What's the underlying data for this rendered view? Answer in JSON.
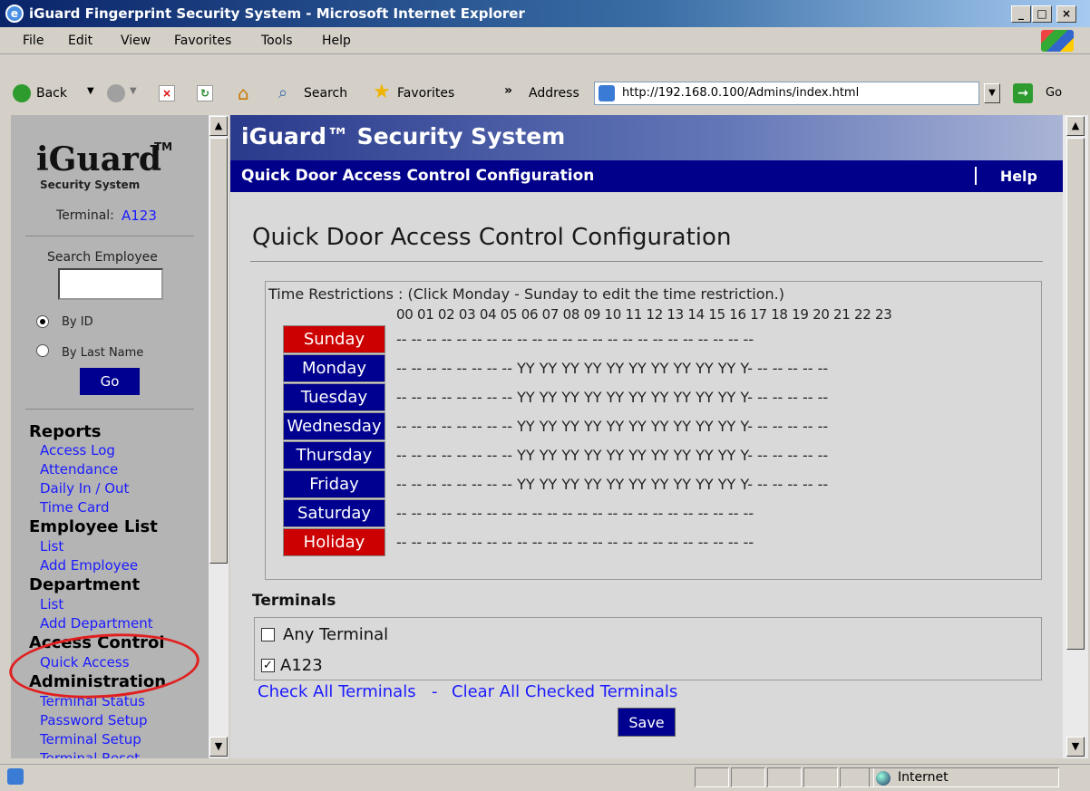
{
  "window": {
    "title": "iGuard Fingerprint Security System - Microsoft Internet Explorer"
  },
  "menu": [
    "File",
    "Edit",
    "View",
    "Favorites",
    "Tools",
    "Help"
  ],
  "toolbar": {
    "back": "Back",
    "search": "Search",
    "favorites": "Favorites",
    "address_label": "Address",
    "url": "http://192.168.0.100/Admins/index.html",
    "go": "Go"
  },
  "sidebar": {
    "logo": "iGuard",
    "logo_tm": "TM",
    "logo_sub": "Security System",
    "terminal_label": "Terminal:",
    "terminal_value": "A123",
    "search_label": "Search Employee",
    "search_value": "",
    "by_id": "By ID",
    "by_last_name": "By Last Name",
    "go": "Go",
    "reports": "Reports",
    "access_log": "Access Log",
    "attendance": "Attendance",
    "daily": "Daily In / Out",
    "time_card": "Time Card",
    "employee_list": "Employee List",
    "emp_list": "List",
    "add_employee": "Add Employee",
    "department": "Department",
    "dept_list": "List",
    "add_department": "Add Department",
    "access_control": "Access Control",
    "quick_access": "Quick Access",
    "administration": "Administration",
    "terminal_status": "Terminal Status",
    "password_setup": "Password Setup",
    "terminal_setup": "Terminal Setup",
    "terminal_reset": "Terminal Reset"
  },
  "header": {
    "brand": "iGuard™ Security System",
    "section": "Quick Door Access Control Configuration",
    "help": "Help"
  },
  "main": {
    "title": "Quick Door Access Control Configuration",
    "time_caption": "Time Restrictions : (Click Monday - Sunday to edit the time restriction.)",
    "hours_header": "00 01 02 03 04 05 06 07 08 09 10 11 12 13 14 15 16 17 18 19 20 21 22 23",
    "days": [
      {
        "label": "Sunday",
        "slots": "-- -- -- -- -- -- -- -- -- -- -- -- -- -- -- -- -- -- -- -- -- -- -- --"
      },
      {
        "label": "Monday",
        "slots": "-- -- -- -- -- -- -- -- YY YY YY YY YY YY YY YY YY YY Y- -- -- -- -- --"
      },
      {
        "label": "Tuesday",
        "slots": "-- -- -- -- -- -- -- -- YY YY YY YY YY YY YY YY YY YY Y- -- -- -- -- --"
      },
      {
        "label": "Wednesday",
        "slots": "-- -- -- -- -- -- -- -- YY YY YY YY YY YY YY YY YY YY Y- -- -- -- -- --"
      },
      {
        "label": "Thursday",
        "slots": "-- -- -- -- -- -- -- -- YY YY YY YY YY YY YY YY YY YY Y- -- -- -- -- --"
      },
      {
        "label": "Friday",
        "slots": "-- -- -- -- -- -- -- -- YY YY YY YY YY YY YY YY YY YY Y- -- -- -- -- --"
      },
      {
        "label": "Saturday",
        "slots": "-- -- -- -- -- -- -- -- -- -- -- -- -- -- -- -- -- -- -- -- -- -- -- --"
      },
      {
        "label": "Holiday",
        "slots": "-- -- -- -- -- -- -- -- -- -- -- -- -- -- -- -- -- -- -- -- -- -- -- --"
      }
    ],
    "terminals_label": "Terminals",
    "any_terminal": "Any Terminal",
    "any_checked": false,
    "a123": "A123",
    "a123_checked": true,
    "check_all": "Check All Terminals",
    "dash": " - ",
    "clear_all": "Clear All Checked Terminals",
    "save": "Save"
  },
  "status": {
    "zone": "Internet"
  },
  "colors": {
    "holiday_red": "#cc0000",
    "weekday_blue": "#000090",
    "header_navy": "#00008b",
    "annotation": "#e02020"
  }
}
